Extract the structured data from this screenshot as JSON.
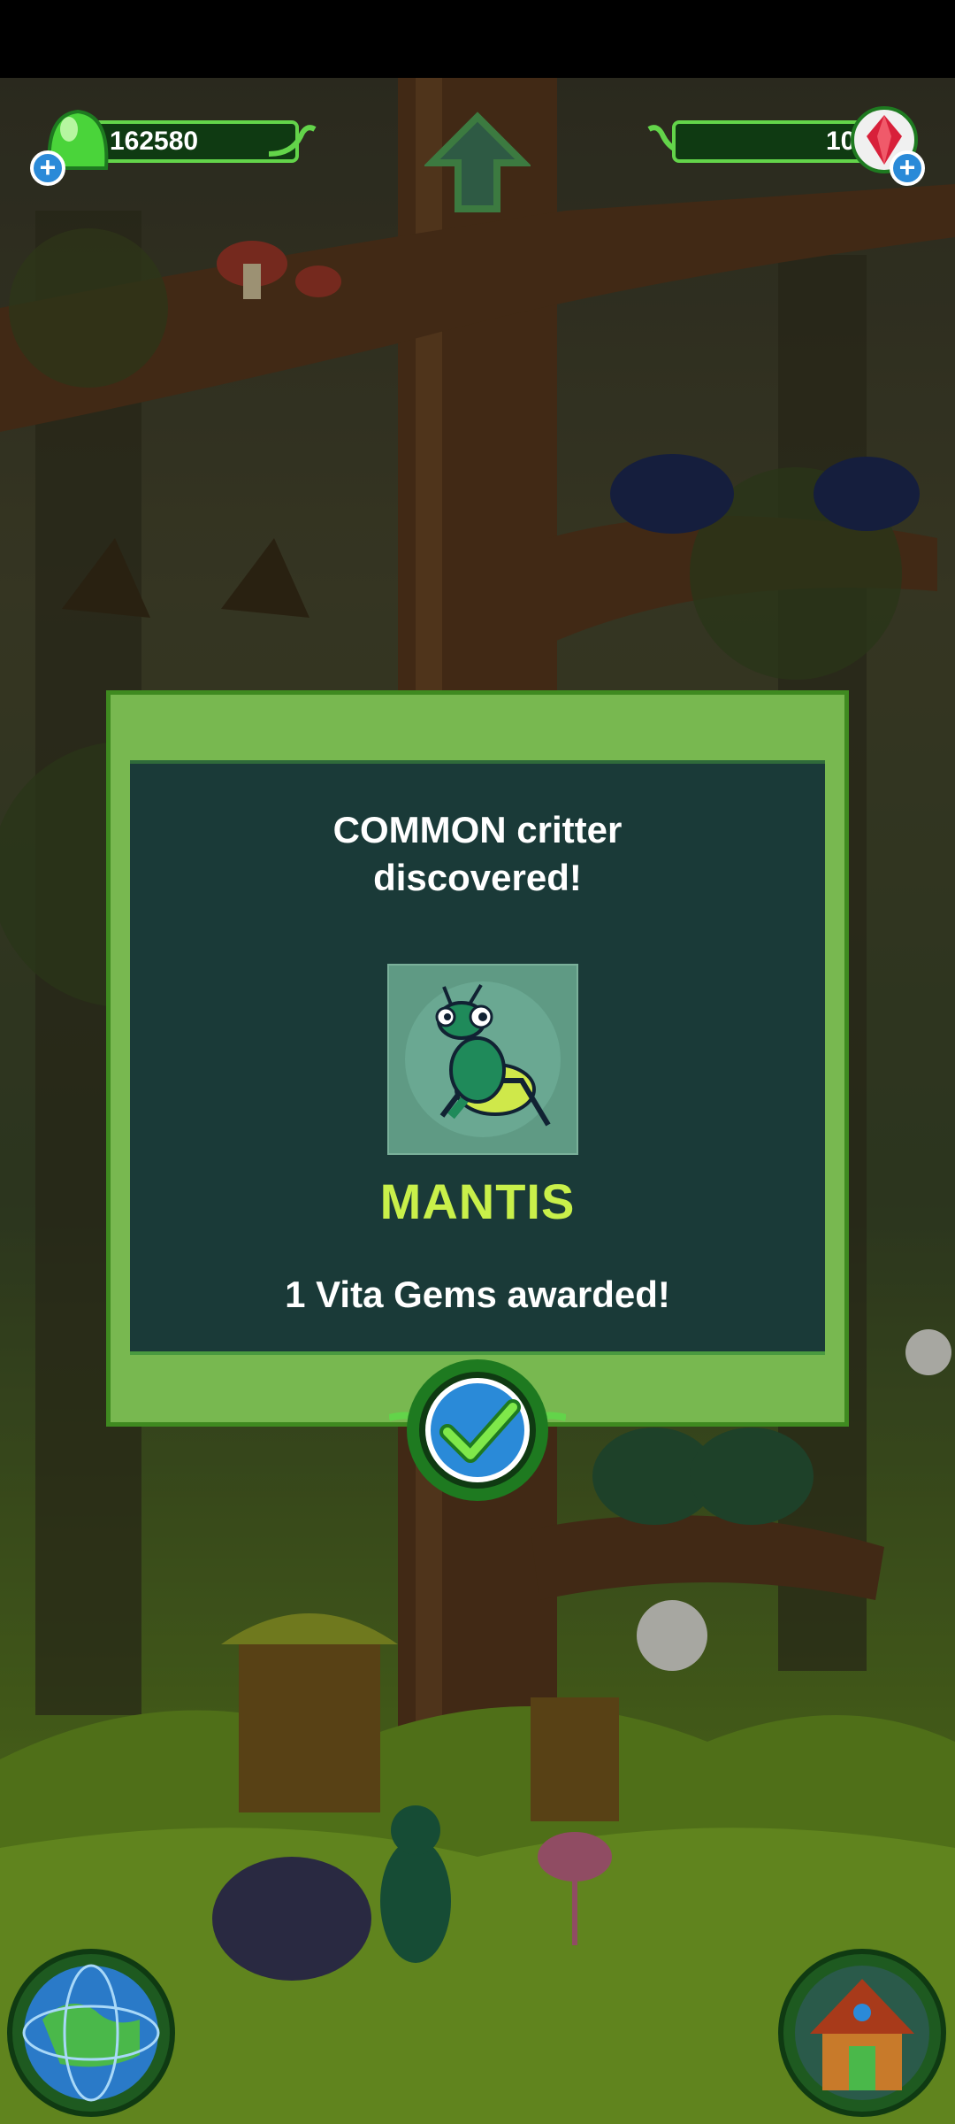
{
  "hud": {
    "coins": "162580",
    "gems": "106"
  },
  "dialog": {
    "title_line1": "COMMON critter",
    "title_line2": "discovered!",
    "critter_name": "MANTIS",
    "award_text": "1 Vita Gems awarded!"
  },
  "colors": {
    "dialog_frame": "#78b850",
    "dialog_panel": "#1a3a38",
    "critter_name": "#c9f04a",
    "confirm_button": "#2a8ad8"
  },
  "icons": {
    "coin": "green-gumdrop-icon",
    "gem": "red-gem-icon",
    "add": "plus-icon",
    "up": "up-arrow-icon",
    "confirm": "checkmark-icon",
    "world": "globe-icon",
    "home": "house-icon"
  }
}
